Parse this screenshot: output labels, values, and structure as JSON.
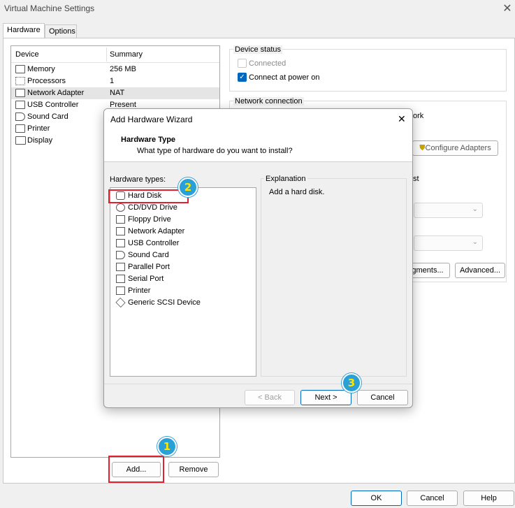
{
  "window": {
    "title": "Virtual Machine Settings",
    "close_glyph": "✕"
  },
  "tabs": [
    {
      "label": "Hardware"
    },
    {
      "label": "Options"
    }
  ],
  "device_list": {
    "col_device": "Device",
    "col_summary": "Summary",
    "rows": [
      {
        "name": "Memory",
        "summary": "256 MB",
        "icon": "memory-icon"
      },
      {
        "name": "Processors",
        "summary": "1",
        "icon": "processor-icon"
      },
      {
        "name": "Network Adapter",
        "summary": "NAT",
        "icon": "network-icon"
      },
      {
        "name": "USB Controller",
        "summary": "Present",
        "icon": "usb-icon"
      },
      {
        "name": "Sound Card",
        "summary": "",
        "icon": "sound-icon"
      },
      {
        "name": "Printer",
        "summary": "",
        "icon": "printer-icon"
      },
      {
        "name": "Display",
        "summary": "",
        "icon": "display-icon"
      }
    ],
    "add_label": "Add...",
    "remove_label": "Remove"
  },
  "device_status": {
    "label": "Device status",
    "connected": "Connected",
    "connect_power": "Connect at power on"
  },
  "network_connection": {
    "label": "Network connection",
    "partial_text_1": "ork",
    "partial_text_2": "st",
    "configure_label": "Configure Adapters",
    "segments_label": "gments...",
    "advanced_label": "Advanced..."
  },
  "wizard": {
    "title": "Add Hardware Wizard",
    "close_glyph": "✕",
    "header_title": "Hardware Type",
    "header_subtitle": "What type of hardware do you want to install?",
    "types_label": "Hardware types:",
    "types": [
      "Hard Disk",
      "CD/DVD Drive",
      "Floppy Drive",
      "Network Adapter",
      "USB Controller",
      "Sound Card",
      "Parallel Port",
      "Serial Port",
      "Printer",
      "Generic SCSI Device"
    ],
    "explanation_label": "Explanation",
    "explanation_text": "Add a hard disk.",
    "back_label": "< Back",
    "next_label": "Next >",
    "cancel_label": "Cancel"
  },
  "footer": {
    "ok_label": "OK",
    "cancel_label": "Cancel",
    "help_label": "Help"
  },
  "badges": {
    "b1": "1",
    "b2": "2",
    "b3": "3"
  },
  "colors": {
    "accent": "#0067c0",
    "highlight": "#e0212f",
    "badge": "#2aa0d8",
    "badge_text": "#ffe600"
  }
}
